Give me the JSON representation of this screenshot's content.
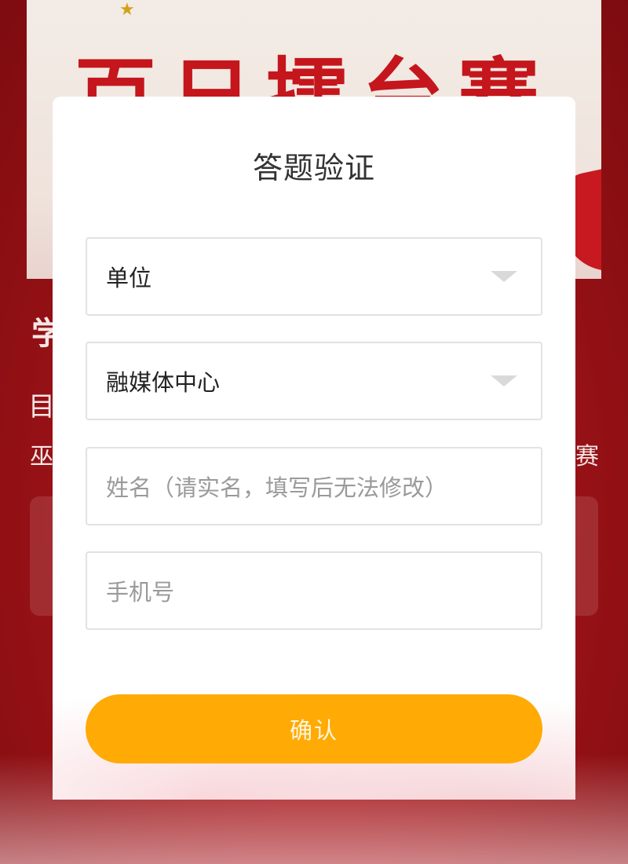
{
  "background": {
    "banner_title": "百日擂台赛",
    "side_text_1": "学",
    "side_text_2": "目",
    "side_text_3": "巫",
    "side_text_4": "赛"
  },
  "dialog": {
    "title": "答题验证",
    "unit_select": {
      "value": "单位"
    },
    "department_select": {
      "value": "融媒体中心"
    },
    "name_input": {
      "placeholder": "姓名（请实名，填写后无法修改）"
    },
    "phone_input": {
      "placeholder": "手机号"
    },
    "confirm_label": "确认"
  },
  "colors": {
    "accent": "#ffaa05",
    "backdrop": "#a8151a",
    "banner_red": "#c4161c"
  }
}
